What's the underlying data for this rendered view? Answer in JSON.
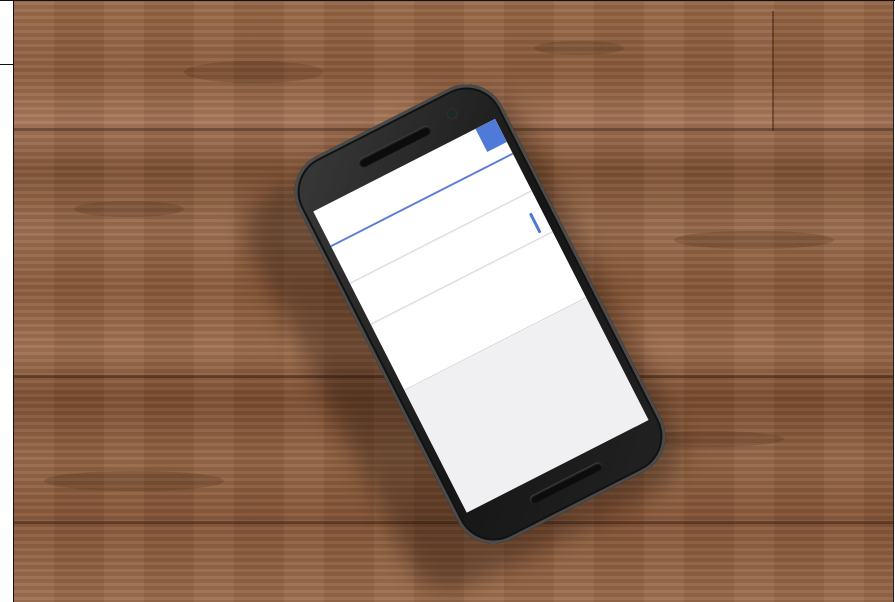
{
  "scene": {
    "subject": "smartphone",
    "surface": "wood",
    "colors": {
      "wood": "#8c5c3c",
      "phone_body": "#1c1c1c",
      "screen_bg": "#f4f4f6",
      "app_accent": "#4f7ad8"
    }
  },
  "screen": {
    "app_bar": {
      "title": "",
      "accent_icon": "blue-tab"
    },
    "rows": [
      {
        "text": "",
        "style": "muted"
      },
      {
        "text": "",
        "style": "normal"
      },
      {
        "text": "",
        "style": "normal"
      },
      {
        "text": "",
        "style": "bold"
      },
      {
        "text": "",
        "style": "muted"
      },
      {
        "text": "",
        "style": "muted"
      }
    ]
  }
}
